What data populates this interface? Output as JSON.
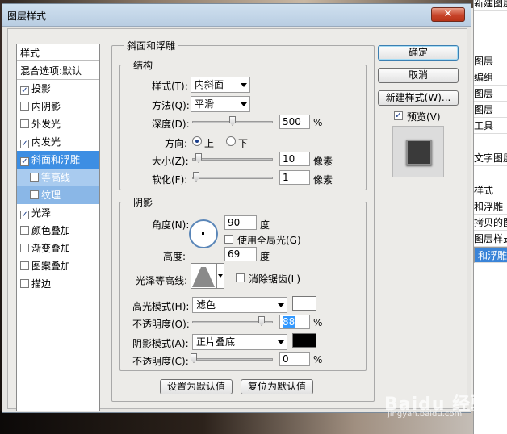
{
  "window": {
    "title": "图层样式"
  },
  "background_panel": {
    "items": [
      "新建图层",
      "图层",
      "编组",
      "图层",
      "图层",
      "工具",
      "文字图层",
      "样式",
      "和浮雕",
      "拷贝的图",
      "图层样式",
      "和浮雕"
    ]
  },
  "sidebar": {
    "header": "样式",
    "blend_options": "混合选项:默认",
    "items": [
      {
        "label": "投影",
        "checked": true
      },
      {
        "label": "内阴影",
        "checked": false
      },
      {
        "label": "外发光",
        "checked": false
      },
      {
        "label": "内发光",
        "checked": true
      },
      {
        "label": "斜面和浮雕",
        "checked": true,
        "active": true
      },
      {
        "label": "等高线",
        "checked": false
      },
      {
        "label": "纹理",
        "checked": false
      },
      {
        "label": "光泽",
        "checked": true
      },
      {
        "label": "颜色叠加",
        "checked": false
      },
      {
        "label": "渐变叠加",
        "checked": false
      },
      {
        "label": "图案叠加",
        "checked": false
      },
      {
        "label": "描边",
        "checked": false
      }
    ]
  },
  "bevel": {
    "title": "斜面和浮雕",
    "structure": {
      "title": "结构",
      "style_label": "样式(T):",
      "style_value": "内斜面",
      "technique_label": "方法(Q):",
      "technique_value": "平滑",
      "depth_label": "深度(D):",
      "depth_value": "500",
      "depth_unit": "%",
      "direction_label": "方向:",
      "dir_up": "上",
      "dir_down": "下",
      "size_label": "大小(Z):",
      "size_value": "10",
      "size_unit": "像素",
      "soften_label": "软化(F):",
      "soften_value": "1",
      "soften_unit": "像素"
    },
    "shading": {
      "title": "阴影",
      "angle_label": "角度(N):",
      "angle_value": "90",
      "angle_unit": "度",
      "global_light_label": "使用全局光(G)",
      "altitude_label": "高度:",
      "altitude_value": "69",
      "altitude_unit": "度",
      "gloss_label": "光泽等高线:",
      "antialias_label": "消除锯齿(L)",
      "highlight_label": "高光模式(H):",
      "highlight_value": "滤色",
      "highlight_color": "#ffffff",
      "hl_opacity_label": "不透明度(O):",
      "hl_opacity_value": "88",
      "hl_opacity_unit": "%",
      "shadow_label": "阴影模式(A):",
      "shadow_value": "正片叠底",
      "shadow_color": "#000000",
      "sh_opacity_label": "不透明度(C):",
      "sh_opacity_value": "0",
      "sh_opacity_unit": "%"
    },
    "make_default": "设置为默认值",
    "reset_default": "复位为默认值"
  },
  "actions": {
    "ok": "确定",
    "cancel": "取消",
    "new_style": "新建样式(W)...",
    "preview": "预览(V)"
  },
  "watermark": {
    "brand": "Baidu 经验",
    "url": "jingyan.baidu.com"
  }
}
